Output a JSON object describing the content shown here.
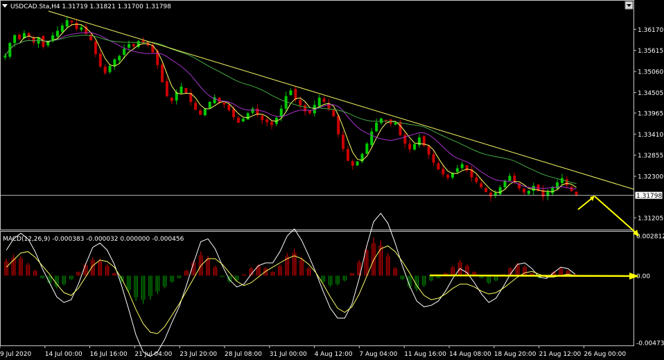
{
  "header": {
    "symbol_line": "USDCAD.Sta,H4  1.31719 1.31821 1.31700 1.31798",
    "macd_line": "MACD(12,26,9) -0.000383 -0.000032 0.000000 -0.000456"
  },
  "price_scale": {
    "labels": [
      "1.36170",
      "1.35615",
      "1.35060",
      "1.34505",
      "1.33965",
      "1.33410",
      "1.32855",
      "1.32300",
      "1.31205"
    ],
    "current_price_label": "1.31798"
  },
  "macd_scale": {
    "labels": [
      "0.002812",
      "0.00",
      "-0.004736"
    ]
  },
  "time_axis": {
    "labels": [
      "9 Jul 2020",
      "14 Jul 00:00",
      "16 Jul 16:00",
      "21 Jul 04:00",
      "23 Jul 20:00",
      "28 Jul 08:00",
      "31 Jul 00:00",
      "4 Aug 12:00",
      "7 Aug 04:00",
      "11 Aug 16:00",
      "14 Aug 08:00",
      "18 Aug 20:00",
      "21 Aug 12:00",
      "26 Aug 00:00"
    ]
  },
  "colors": {
    "background": "#000000",
    "bull_candle": "#00cc00",
    "bear_candle": "#cc0000",
    "macd_positive": "#cc0000",
    "macd_negative": "#008800",
    "fast_ma": "#ffff66",
    "mid_ma": "#aa33cc",
    "slow_ma": "#44aa44",
    "trendline": "#ffff66",
    "arrow": "#ffff00",
    "grid_line": "#c8c8c8"
  },
  "chart_data": {
    "type": "candlestick",
    "symbol": "USDCAD.Sta",
    "timeframe": "H4",
    "last_bar": {
      "open": 1.31719,
      "high": 1.31821,
      "low": 1.317,
      "close": 1.31798
    },
    "ylim": [
      1.3095,
      1.3665
    ],
    "closes": [
      1.3548,
      1.3581,
      1.3602,
      1.3591,
      1.3607,
      1.3598,
      1.3582,
      1.3596,
      1.3571,
      1.3585,
      1.3601,
      1.3613,
      1.3627,
      1.3641,
      1.3636,
      1.3618,
      1.3622,
      1.3605,
      1.3588,
      1.3552,
      1.3519,
      1.3502,
      1.3521,
      1.3538,
      1.3547,
      1.3566,
      1.3578,
      1.3572,
      1.3586,
      1.3581,
      1.3575,
      1.3556,
      1.3523,
      1.3478,
      1.3441,
      1.3428,
      1.3451,
      1.3466,
      1.3449,
      1.3426,
      1.3405,
      1.3392,
      1.3407,
      1.3426,
      1.3438,
      1.3425,
      1.3419,
      1.3404,
      1.3386,
      1.3371,
      1.3382,
      1.3396,
      1.3408,
      1.3391,
      1.3378,
      1.3372,
      1.3365,
      1.3384,
      1.3408,
      1.3441,
      1.3456,
      1.3432,
      1.3417,
      1.3401,
      1.3396,
      1.3418,
      1.3437,
      1.3426,
      1.3408,
      1.3388,
      1.3341,
      1.3302,
      1.3271,
      1.3258,
      1.3269,
      1.3289,
      1.3316,
      1.3348,
      1.3371,
      1.3382,
      1.3377,
      1.3368,
      1.3371,
      1.3338,
      1.3316,
      1.3301,
      1.3315,
      1.3332,
      1.3311,
      1.3287,
      1.3266,
      1.3248,
      1.3235,
      1.3226,
      1.3239,
      1.3251,
      1.3262,
      1.3245,
      1.3227,
      1.3215,
      1.3201,
      1.3188,
      1.3176,
      1.3186,
      1.3201,
      1.3218,
      1.3231,
      1.3215,
      1.3198,
      1.3187,
      1.3192,
      1.3205,
      1.3191,
      1.3176,
      1.3189,
      1.3201,
      1.3214,
      1.3225,
      1.3206,
      1.3191,
      1.318
    ],
    "macd_histogram": [
      0.0012,
      0.0015,
      0.0014,
      0.0009,
      0.0004,
      -0.0002,
      -0.0006,
      -0.0009,
      -0.0007,
      -0.0003,
      0.0003,
      0.0009,
      0.0013,
      0.0012,
      0.0008,
      0.0002,
      -0.0005,
      -0.0012,
      -0.0018,
      -0.002,
      -0.0017,
      -0.0013,
      -0.0009,
      -0.0005,
      -0.0002,
      0.0004,
      0.0011,
      0.0017,
      0.0014,
      0.0007,
      -0.0001,
      -0.0005,
      -0.0004,
      0.0001,
      0.0006,
      0.0008,
      0.0006,
      0.0003,
      0.0008,
      0.0016,
      0.0019,
      0.0013,
      0.0006,
      0.0,
      -0.0005,
      -0.0008,
      -0.0007,
      -0.0004,
      0.0002,
      0.0011,
      0.0021,
      0.0027,
      0.0025,
      0.0016,
      0.0006,
      -0.0003,
      -0.0009,
      -0.0011,
      -0.0008,
      -0.0004,
      -0.0002,
      0.0002,
      0.0007,
      0.0011,
      0.0008,
      0.0003,
      -0.0002,
      -0.0006,
      -0.0004,
      0.0001,
      0.0006,
      0.0009,
      0.0007,
      0.0002,
      -0.0002,
      -0.0001,
      0.0003,
      0.0006,
      0.0004,
      0.0001
    ],
    "macd_signal": [
      0.0006,
      0.0011,
      0.0016,
      0.0017,
      0.0013,
      0.0007,
      0.0001,
      -0.0006,
      -0.0012,
      -0.0014,
      -0.0009,
      -0.0001,
      0.0007,
      0.0011,
      0.001,
      0.0006,
      -0.0002,
      -0.0012,
      -0.0024,
      -0.0034,
      -0.004,
      -0.0041,
      -0.0036,
      -0.0028,
      -0.002,
      -0.0011,
      -0.0002,
      0.0007,
      0.0012,
      0.0012,
      0.0008,
      0.0002,
      -0.0004,
      -0.0007,
      -0.0005,
      -0.0001,
      0.0003,
      0.0006,
      0.0009,
      0.0012,
      0.0014,
      0.0012,
      0.0008,
      0.0002,
      -0.0006,
      -0.0015,
      -0.0023,
      -0.0026,
      -0.0022,
      -0.0013,
      -0.0001,
      0.0011,
      0.0019,
      0.0021,
      0.0017,
      0.001,
      0.0002,
      -0.0007,
      -0.0014,
      -0.0017,
      -0.0016,
      -0.0013,
      -0.0009,
      -0.0006,
      -0.0006,
      -0.0008,
      -0.0011,
      -0.0013,
      -0.0012,
      -0.0009,
      -0.0005,
      -0.0001,
      0.0002,
      0.0003,
      0.0001,
      -0.0001,
      -0.0001,
      0.0,
      0.0001,
      0.0
    ],
    "macd_ylim": [
      -0.004736,
      0.002812
    ],
    "trendline": {
      "start": 1.3665,
      "end": 1.3196
    },
    "annotations": [
      "yellow up arrow",
      "yellow down arrow",
      "yellow horizontal line at MACD 0.00"
    ]
  }
}
